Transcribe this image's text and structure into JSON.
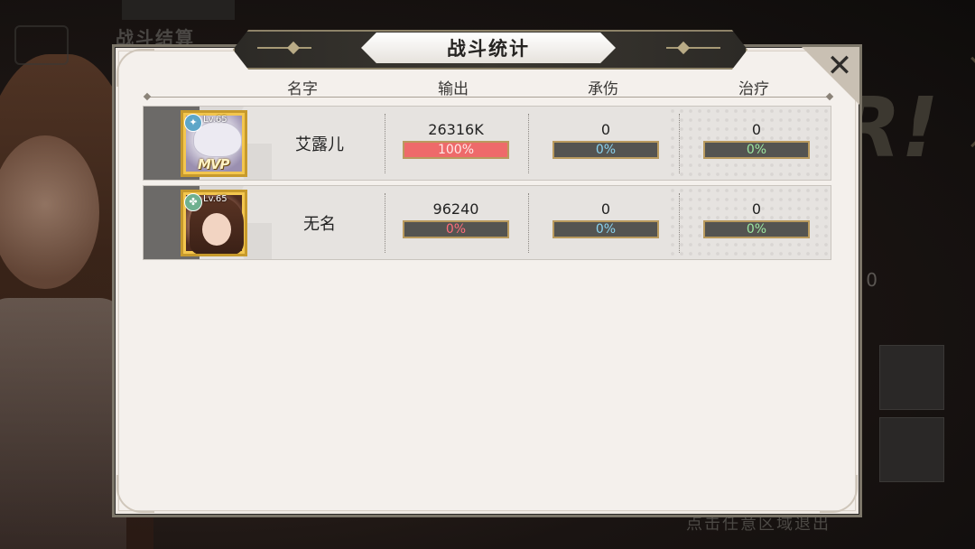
{
  "background": {
    "screen_title": "战斗结算",
    "hint_text": "点击任意区域退出",
    "right_big_text": "R!",
    "side_number": "0"
  },
  "dialog": {
    "title": "战斗统计",
    "close_glyph": "✕",
    "headers": {
      "name": "名字",
      "output": "输出",
      "damage_taken": "承伤",
      "healing": "治疗"
    }
  },
  "players": [
    {
      "name": "艾露儿",
      "level": "Lv.65",
      "element_icon": "wind-icon",
      "mvp": "MVP",
      "portrait": "silver",
      "output": {
        "value": "26316K",
        "percent_text": "100%",
        "fraction": 1.0
      },
      "damage_taken": {
        "value": "0",
        "percent_text": "0%",
        "fraction": 0
      },
      "healing": {
        "value": "0",
        "percent_text": "0%",
        "fraction": 0
      }
    },
    {
      "name": "无名",
      "level": "Lv.65",
      "element_icon": "leaf-icon",
      "mvp": "",
      "portrait": "brown",
      "output": {
        "value": "96240",
        "percent_text": "0%",
        "fraction": 0
      },
      "damage_taken": {
        "value": "0",
        "percent_text": "0%",
        "fraction": 0
      },
      "healing": {
        "value": "0",
        "percent_text": "0%",
        "fraction": 0
      }
    }
  ],
  "colors": {
    "output_text": "#ff6d7a",
    "output_text_full": "#ffe9e9",
    "damage_taken_text": "#8ad2ee",
    "healing_text": "#9be6a0",
    "output_fill": "#ee6a6a"
  }
}
